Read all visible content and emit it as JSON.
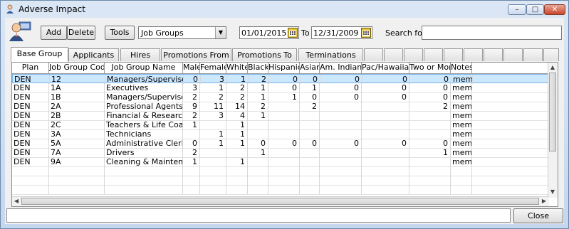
{
  "window": {
    "title": "Adverse Impact",
    "controls": [
      "–",
      "□",
      "✕"
    ]
  },
  "toolbar": {
    "add_label": "Add",
    "delete_label": "Delete",
    "tools_label": "Tools",
    "group_select_value": "Job Groups",
    "date_from": "01/01/2015",
    "to_label": "To",
    "date_to": "12/31/2009",
    "search_label": "Search for :",
    "search_value": ""
  },
  "tabs": [
    {
      "label": "Base Group",
      "active": true
    },
    {
      "label": "Applicants"
    },
    {
      "label": "Hires"
    },
    {
      "label": "Promotions From"
    },
    {
      "label": "Promotions To"
    },
    {
      "label": "Terminations"
    }
  ],
  "grid": {
    "columns": [
      "Plan",
      "Job Group Code",
      "Job Group Name",
      "Male",
      "Female",
      "White",
      "Black",
      "Hispanic",
      "Asian",
      "Am. Indian",
      "Pac/Hawaiian",
      "Two or More",
      "Notes"
    ],
    "rows": [
      [
        "DEN",
        "12",
        "Managers/Supervisors",
        "0",
        "3",
        "1",
        "2",
        "0",
        "0",
        "0",
        "0",
        "0",
        "memo"
      ],
      [
        "DEN",
        "1A",
        "Executives",
        "3",
        "1",
        "2",
        "1",
        "0",
        "1",
        "0",
        "0",
        "0",
        "memo"
      ],
      [
        "DEN",
        "1B",
        "Managers/Supervisors",
        "2",
        "2",
        "2",
        "1",
        "1",
        "0",
        "0",
        "0",
        "0",
        "memo"
      ],
      [
        "DEN",
        "2A",
        "Professional Agents & P",
        "9",
        "11",
        "14",
        "2",
        "",
        "2",
        "",
        "",
        "2",
        "memo"
      ],
      [
        "DEN",
        "2B",
        "Financial & Research Pr",
        "2",
        "3",
        "4",
        "1",
        "",
        "",
        "",
        "",
        "",
        "memo"
      ],
      [
        "DEN",
        "2C",
        "Teachers & Life Coaches",
        "1",
        "",
        "1",
        "",
        "",
        "",
        "",
        "",
        "",
        "memo"
      ],
      [
        "DEN",
        "3A",
        "Technicians",
        "",
        "1",
        "1",
        "",
        "",
        "",
        "",
        "",
        "",
        "memo"
      ],
      [
        "DEN",
        "5A",
        "Administrative Clerical",
        "0",
        "1",
        "1",
        "0",
        "0",
        "0",
        "0",
        "0",
        "0",
        "memo"
      ],
      [
        "DEN",
        "7A",
        "Drivers",
        "2",
        "",
        "",
        "1",
        "",
        "",
        "",
        "",
        "1",
        "memo"
      ],
      [
        "DEN",
        "9A",
        "Cleaning & Maintenance",
        "1",
        "",
        "1",
        "",
        "",
        "",
        "",
        "",
        "",
        "memo"
      ]
    ],
    "selected_row": 0
  },
  "footer": {
    "status_text": "",
    "close_label": "Close"
  }
}
